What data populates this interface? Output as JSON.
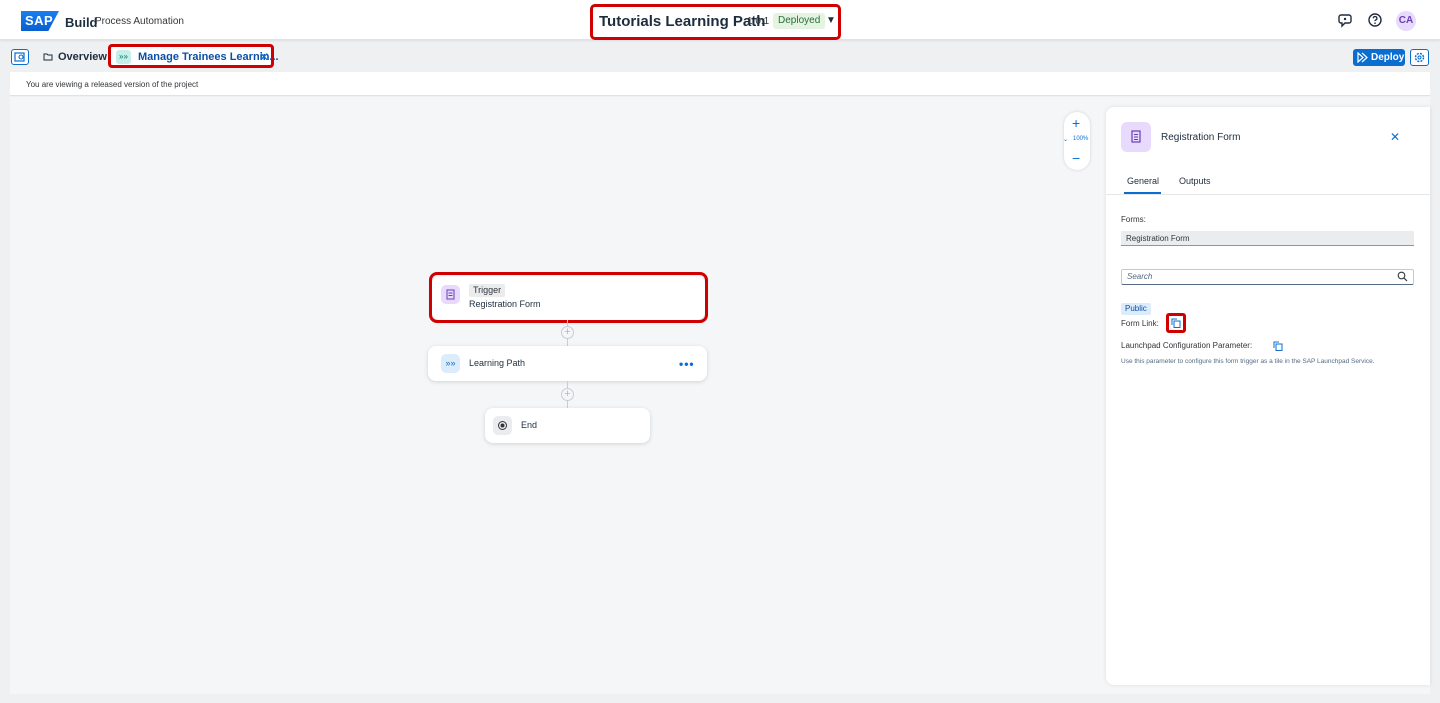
{
  "shell": {
    "logo": "SAP",
    "brand": "Build",
    "product": "Process Automation",
    "avatar_initials": "CA",
    "icons": [
      "feedback-icon",
      "help-icon"
    ]
  },
  "project": {
    "title": "Tutorials Learning Path",
    "version": "1.0.1",
    "status": "Deployed"
  },
  "tabs": {
    "overview_label": "Overview",
    "active_label": "Manage Trainees Learnin...",
    "deploy_label": "Deploy"
  },
  "info": {
    "message": "You are viewing a released version of the project"
  },
  "zoom": {
    "level": "100%"
  },
  "flow": {
    "trigger_badge": "Trigger",
    "trigger_name": "Registration Form",
    "subprocess_name": "Learning Path",
    "end_name": "End"
  },
  "panel": {
    "title": "Registration Form",
    "tab_general": "General",
    "tab_outputs": "Outputs",
    "forms_label": "Forms:",
    "forms_value": "Registration Form",
    "search_placeholder": "Search",
    "public_badge": "Public",
    "form_link_label": "Form Link:",
    "launchpad_label": "Launchpad Configuration Parameter:",
    "launchpad_help": "Use this parameter to configure this form trigger as a tile in the SAP Launchpad Service."
  },
  "colors": {
    "accent": "#0a6ed1",
    "highlight": "#d10000",
    "deployed_bg": "#e5f3e1",
    "form_icon_bg": "#e8dafc"
  }
}
